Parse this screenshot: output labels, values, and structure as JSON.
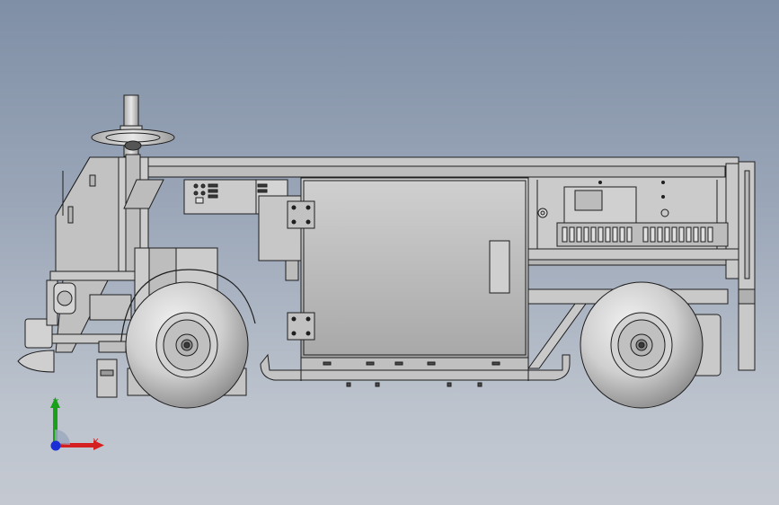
{
  "viewport": {
    "background_top": "#7f8fa6",
    "background_bottom": "#c4c9d1",
    "model_fill": "#c9c9c9",
    "model_edge": "#1e1e1e"
  },
  "triad": {
    "y_label": "Y",
    "x_label": "X",
    "y_color": "#1aa01a",
    "x_color": "#d42020",
    "z_color": "#1b2fd6"
  }
}
